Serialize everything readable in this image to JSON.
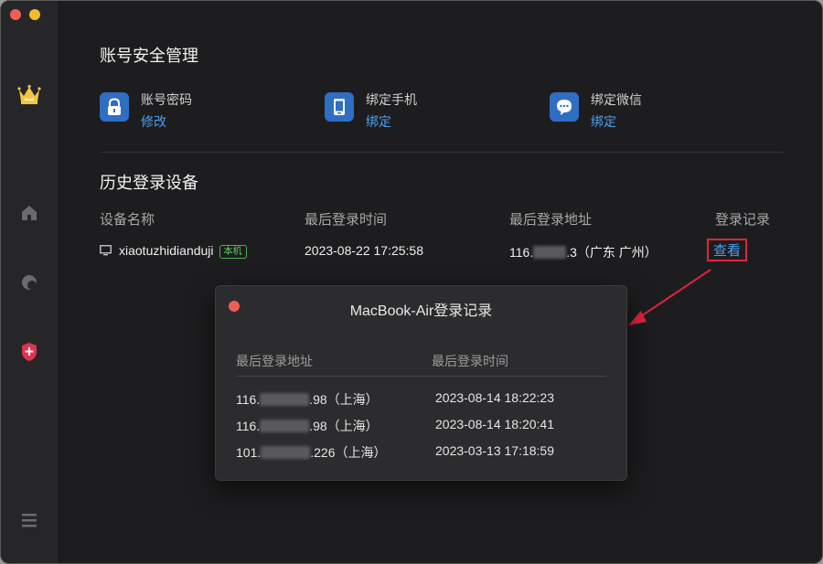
{
  "account_security": {
    "title": "账号安全管理",
    "items": [
      {
        "label": "账号密码",
        "action": "修改",
        "icon": "lock-icon"
      },
      {
        "label": "绑定手机",
        "action": "绑定",
        "icon": "phone-icon"
      },
      {
        "label": "绑定微信",
        "action": "绑定",
        "icon": "wechat-icon"
      }
    ]
  },
  "history": {
    "title": "历史登录设备",
    "columns": [
      "设备名称",
      "最后登录时间",
      "最后登录地址",
      "登录记录"
    ],
    "rows": [
      {
        "device": "xiaotuzhidianduji",
        "badge": "本机",
        "time": "2023-08-22 17:25:58",
        "ip_prefix": "116.",
        "ip_suffix": ".3（广东 广州）",
        "action": "查看"
      }
    ]
  },
  "dialog": {
    "title": "MacBook-Air登录记录",
    "columns": [
      "最后登录地址",
      "最后登录时间"
    ],
    "rows": [
      {
        "ip_prefix": "116.",
        "ip_suffix": ".98（上海）",
        "time": "2023-08-14 18:22:23"
      },
      {
        "ip_prefix": "116.",
        "ip_suffix": ".98（上海）",
        "time": "2023-08-14 18:20:41"
      },
      {
        "ip_prefix": "101.",
        "ip_suffix": ".226（上海）",
        "time": "2023-03-13 17:18:59"
      }
    ]
  },
  "colors": {
    "accent_link": "#4aa0f0",
    "highlight_red": "#e0243c",
    "icon_blue": "#2f6ec2",
    "badge_green": "#5fcf63"
  },
  "sidebar": {
    "icons": [
      "crown-icon",
      "home-icon",
      "moon-icon",
      "shield-plus-icon",
      "menu-icon"
    ]
  }
}
